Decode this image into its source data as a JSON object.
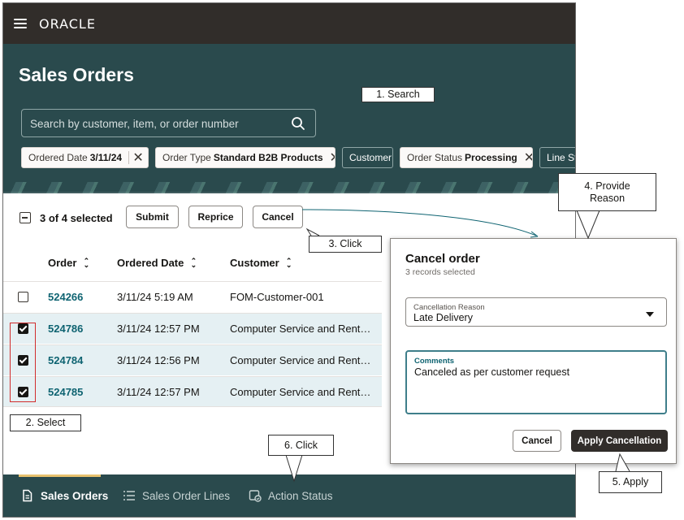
{
  "app": {
    "brand": "ORACLE"
  },
  "header": {
    "title": "Sales Orders",
    "search_placeholder": "Search by customer, item, or order number",
    "filters": [
      {
        "label": "Ordered Date",
        "value": "3/11/24"
      },
      {
        "label": "Order Type",
        "value": "Standard B2B Products"
      },
      {
        "label": "Customer",
        "value": ""
      },
      {
        "label": "Order Status",
        "value": "Processing"
      },
      {
        "label": "Line Sta",
        "value": ""
      }
    ]
  },
  "toolbar": {
    "selected_count": "3 of 4 selected",
    "submit_label": "Submit",
    "reprice_label": "Reprice",
    "cancel_label": "Cancel"
  },
  "table": {
    "columns": [
      "Order",
      "Ordered Date",
      "Customer"
    ],
    "rows": [
      {
        "order": "524266",
        "date": "3/11/24 5:19 AM",
        "customer": "FOM-Customer-001",
        "selected": false
      },
      {
        "order": "524786",
        "date": "3/11/24 12:57 PM",
        "customer": "Computer Service and Rent…",
        "selected": true
      },
      {
        "order": "524784",
        "date": "3/11/24 12:56 PM",
        "customer": "Computer Service and Rent…",
        "selected": true
      },
      {
        "order": "524785",
        "date": "3/11/24 12:57 PM",
        "customer": "Computer Service and Rent…",
        "selected": true
      }
    ]
  },
  "dialog": {
    "title": "Cancel order",
    "subtitle": "3 records selected",
    "reason_label": "Cancellation Reason",
    "reason_value": "Late Delivery",
    "comments_label": "Comments",
    "comments_value": "Canceled as per customer request",
    "cancel_label": "Cancel",
    "apply_label": "Apply Cancellation"
  },
  "bottom_nav": {
    "items": [
      {
        "label": "Sales Orders",
        "icon": "document-icon",
        "active": true
      },
      {
        "label": "Sales Order Lines",
        "icon": "list-icon",
        "active": false
      },
      {
        "label": "Action Status",
        "icon": "action-status-icon",
        "active": false
      }
    ]
  },
  "callouts": {
    "search": "1. Search",
    "select": "2. Select",
    "click_cancel": "3. Click",
    "provide_reason_line1": "4. Provide",
    "provide_reason_line2": "Reason",
    "apply": "5. Apply",
    "click_action": "6. Click"
  },
  "colors": {
    "topbar": "#312d2a",
    "header": "#2a4a4d",
    "link": "#0e6371",
    "selected_row": "#e5f0f3",
    "select_outline": "#d12d2d",
    "nav_indicator": "#e8c26e"
  }
}
